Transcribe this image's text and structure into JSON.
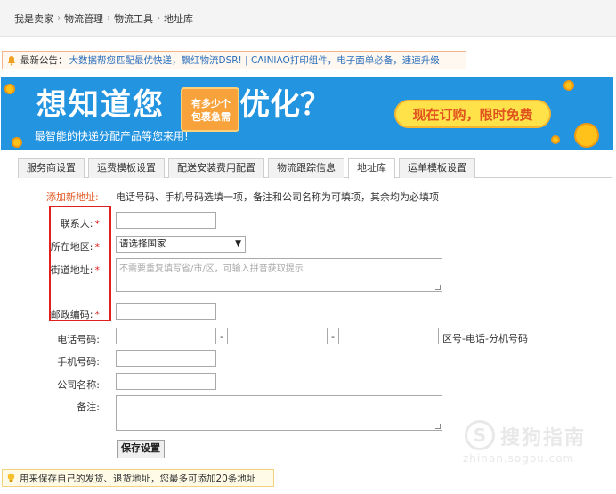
{
  "breadcrumb": {
    "items": [
      "我是卖家",
      "物流管理",
      "物流工具",
      "地址库"
    ],
    "separator": "›"
  },
  "notice": {
    "label": "最新公告：",
    "text": "大数据帮您匹配最优快递，飘红物流DSR! | CAINIAO打印组件，电子面单必备，速速升级"
  },
  "banner": {
    "headline_left": "想知道您",
    "box_line1": "有多少个",
    "box_line2": "包裹急需",
    "headline_right": "优化？",
    "subtitle": "最智能的快递分配产品等您来用!",
    "cta": "现在订购，限时免费"
  },
  "tabs": [
    {
      "label": "服务商设置",
      "active": false
    },
    {
      "label": "运费模板设置",
      "active": false
    },
    {
      "label": "配送安装费用配置",
      "active": false
    },
    {
      "label": "物流跟踪信息",
      "active": false
    },
    {
      "label": "地址库",
      "active": true
    },
    {
      "label": "运单模板设置",
      "active": false
    }
  ],
  "form": {
    "add_title": "添加新地址:",
    "add_hint": "电话号码、手机号码选填一项，备注和公司名称为可填项，其余均为必填项",
    "contact_label": "联系人:",
    "region_label": "所在地区:",
    "region_value": "请选择国家",
    "street_label": "街道地址:",
    "street_placeholder": "不需要重复填写省/市/区，可输入拼音获取提示",
    "zip_label": "邮政编码:",
    "phone_label": "电话号码:",
    "phone_sep": "-",
    "phone_hint": "区号-电话-分机号码",
    "mobile_label": "手机号码:",
    "company_label": "公司名称:",
    "remark_label": "备注:",
    "required_mark": "*",
    "save_label": "保存设置"
  },
  "tip": {
    "text": "用来保存自己的发货、退货地址，您最多可添加20条地址"
  },
  "watermark": {
    "logo": "S",
    "name": "搜狗指南",
    "url": "zhinan.sogou.com"
  },
  "colors": {
    "banner_bg": "#2394e0",
    "required": "#e02222",
    "link": "#2a6ebb",
    "highlight_box": "#e02020"
  }
}
